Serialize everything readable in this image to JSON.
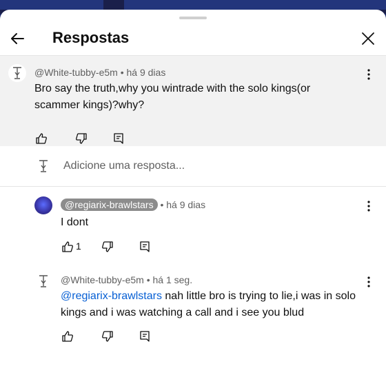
{
  "header": {
    "title": "Respostas"
  },
  "parent_comment": {
    "author": "@White-tubby-e5m",
    "time": "há 9 dias",
    "text": "Bro say the truth,why you wintrade with the solo kings(or scammer kings)?why?"
  },
  "reply_box": {
    "placeholder": "Adicione uma resposta..."
  },
  "replies": [
    {
      "author": "@regiarix-brawlstars",
      "time": "há 9 dias",
      "text": "I dont",
      "likes": "1"
    },
    {
      "author": "@White-tubby-e5m",
      "time": "há 1 seg.",
      "mention": "@regiarix-brawlstars",
      "text": "nah little bro is trying to lie,i was in solo kings and i was watching a call and i see you blud"
    }
  ],
  "separator": "•",
  "icons": {
    "back": "arrow-left-icon",
    "close": "close-icon",
    "like": "thumb-up-icon",
    "dislike": "thumb-down-icon",
    "reply": "comment-icon",
    "menu": "more-vertical-icon"
  },
  "colors": {
    "accent_link": "#065fd4",
    "parent_bg": "#f2f2f2",
    "meta_text": "#606060"
  }
}
